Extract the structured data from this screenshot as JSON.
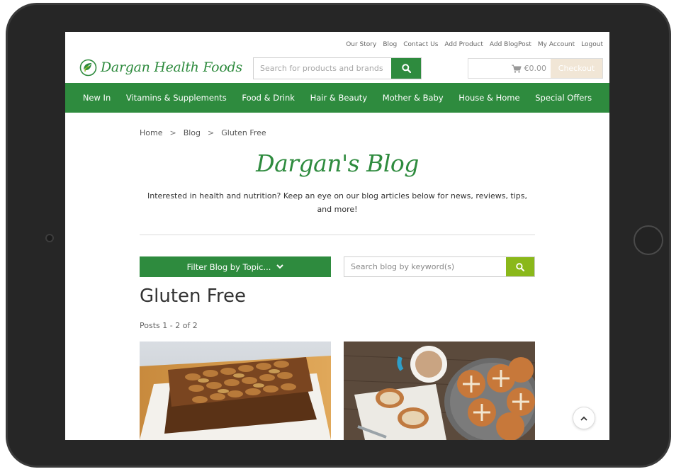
{
  "utility_links": [
    "Our Story",
    "Blog",
    "Contact Us",
    "Add Product",
    "Add BlogPost",
    "My Account",
    "Logout"
  ],
  "logo": {
    "text": "Dargan Health Foods"
  },
  "search": {
    "placeholder": "Search for products and brands",
    "icon": "search-icon"
  },
  "cart": {
    "amount": "€0.00",
    "checkout_label": "Checkout",
    "icon": "cart-icon"
  },
  "nav": [
    "New In",
    "Vitamins & Supplements",
    "Food & Drink",
    "Hair & Beauty",
    "Mother & Baby",
    "House & Home",
    "Special Offers"
  ],
  "breadcrumb": {
    "home": "Home",
    "blog": "Blog",
    "current": "Gluten Free",
    "separator": ">"
  },
  "blog": {
    "title": "Dargan's Blog",
    "intro": "Interested in health and nutrition? Keep an eye on our blog articles below for news, reviews, tips, and more!"
  },
  "filter": {
    "label": "Filter Blog by Topic...",
    "icon": "chevron-down-icon"
  },
  "blog_search": {
    "placeholder": "Search blog by keyword(s)",
    "icon": "search-icon"
  },
  "section": {
    "title": "Gluten Free",
    "posts_count": "Posts 1 - 2 of 2"
  },
  "posts": [
    {
      "image": "fruit-cake-with-pecans"
    },
    {
      "image": "hot-cross-buns-and-tea"
    }
  ],
  "colors": {
    "brand_green": "#2e8b3e",
    "accent_lime": "#8ab81a",
    "checkout_beige": "#f1e6d6"
  }
}
